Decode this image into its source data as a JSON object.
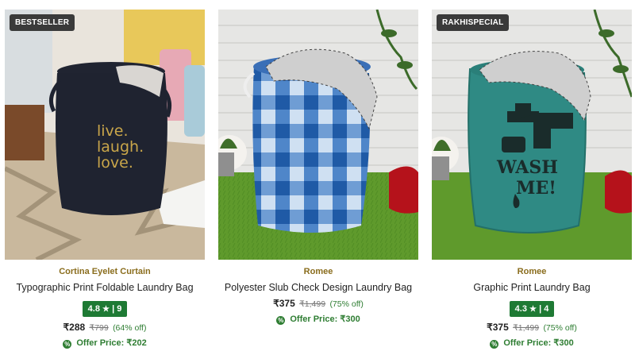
{
  "products": [
    {
      "badge": "BESTSELLER",
      "brand": "Cortina Eyelet Curtain",
      "title": "Typographic Print Foldable Laundry Bag",
      "rating": "4.8",
      "rating_star": "★",
      "rating_sep": "|",
      "reviews": "9",
      "price": "₹288",
      "mrp": "₹799",
      "discount": "(64% off)",
      "offer_label": "Offer Price:",
      "offer_price": "₹202",
      "print_lines": [
        "live.",
        "laugh.",
        "love."
      ]
    },
    {
      "brand": "Romee",
      "title": "Polyester Slub Check Design Laundry Bag",
      "price": "₹375",
      "mrp": "₹1,499",
      "discount": "(75% off)",
      "offer_label": "Offer Price:",
      "offer_price": "₹300"
    },
    {
      "badge": "RAKHISPECIAL",
      "brand": "Romee",
      "title": "Graphic Print Laundry Bag",
      "rating": "4.3",
      "rating_star": "★",
      "rating_sep": "|",
      "reviews": "4",
      "price": "₹375",
      "mrp": "₹1,499",
      "discount": "(75% off)",
      "offer_label": "Offer Price:",
      "offer_price": "₹300",
      "print_lines": [
        "WASH",
        "ME!"
      ]
    }
  ],
  "colors": {
    "rating_bg": "#1e7a34",
    "offer_green": "#2e7d32",
    "brand_gold": "#8a6d1d",
    "badge_bg": "#3a3a3a"
  }
}
